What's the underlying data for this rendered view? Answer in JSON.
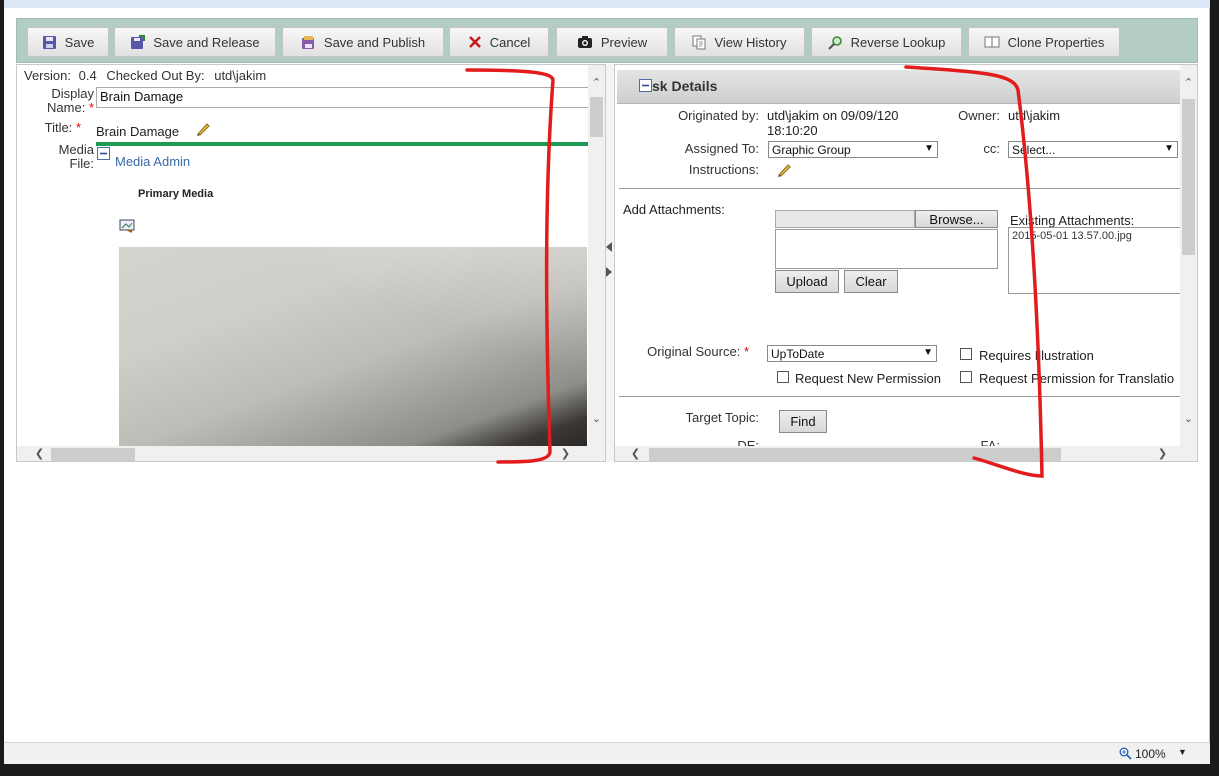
{
  "toolbar": {
    "save": "Save",
    "save_release": "Save and Release",
    "save_publish": "Save and Publish",
    "cancel": "Cancel",
    "preview": "Preview",
    "view_history": "View History",
    "reverse_lookup": "Reverse Lookup",
    "clone_properties": "Clone Properties"
  },
  "left": {
    "version_label": "Version:",
    "version_value": "0.4",
    "checked_out_label": "Checked Out By:",
    "checked_out_value": "utd\\jakim",
    "display_name_label_1": "Display",
    "display_name_label_2": "Name:",
    "required_mark": "*",
    "display_name_value": "Brain Damage",
    "title_label": "Title:",
    "title_value": "Brain Damage",
    "media_file_label_1": "Media",
    "media_file_label_2": "File:",
    "media_admin": "Media Admin",
    "primary_media": "Primary Media"
  },
  "right": {
    "section_title": "sk Details",
    "originated_label": "Originated by:",
    "originated_value_1": "utd\\jakim on 09/09/120",
    "originated_value_2": "18:10:20",
    "owner_label": "Owner:",
    "owner_value": "utd\\jakim",
    "assigned_label": "Assigned To:",
    "assigned_value": "Graphic Group",
    "cc_label": "cc:",
    "cc_value": "Select...",
    "instructions_label": "Instructions:",
    "attachments_label": "Add Attachments:",
    "browse": "Browse...",
    "upload": "Upload",
    "clear": "Clear",
    "existing_label": "Existing Attachments:",
    "existing_file": "2015-05-01 13.57.00.jpg",
    "source_label": "Original Source:",
    "source_value": "UpToDate",
    "requires_illustration": "Requires Illustration",
    "request_new_permission": "Request New Permission",
    "request_translation": "Request Permission for Translatio",
    "target_topic_label": "Target Topic:",
    "find": "Find",
    "de_label": "DE:",
    "fa_label": "FA:"
  },
  "status": {
    "zoom": "100%"
  }
}
